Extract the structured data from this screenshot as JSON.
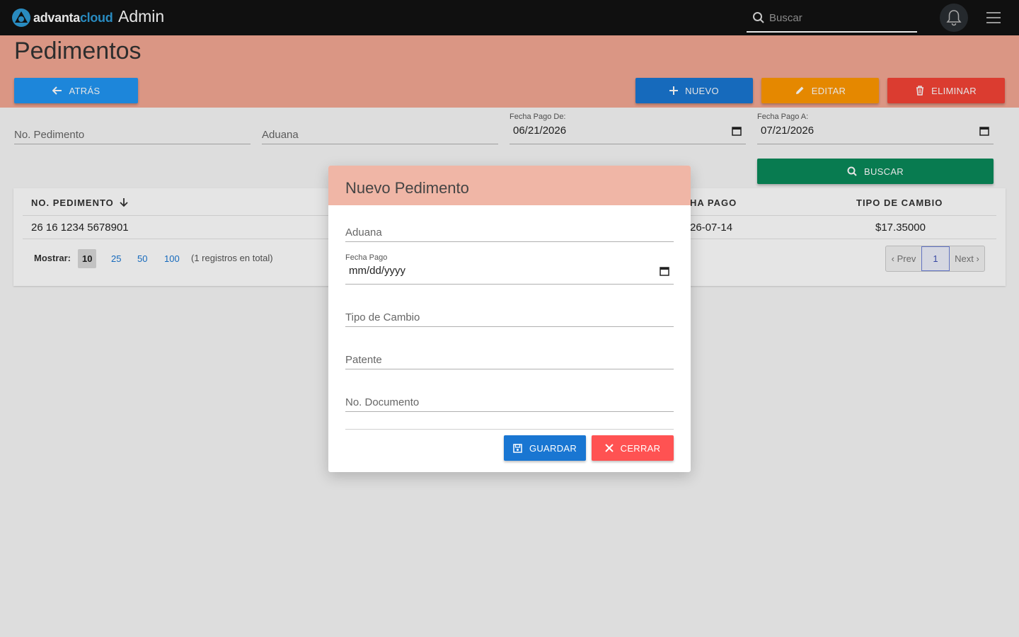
{
  "app": {
    "brand_left": "advanta",
    "brand_right": "cloud",
    "section": "Admin"
  },
  "search": {
    "placeholder": "Buscar"
  },
  "page": {
    "title": "Pedimentos"
  },
  "toolbar": {
    "back_label": "ATRÁS",
    "new_label": "NUEVO",
    "edit_label": "EDITAR",
    "delete_label": "ELIMINAR"
  },
  "filters": {
    "pedimento_placeholder": "No. Pedimento",
    "aduana_placeholder": "Aduana",
    "fecha_de_label": "Fecha Pago De:",
    "fecha_de_value": "06/21/2026",
    "fecha_a_label": "Fecha Pago A:",
    "fecha_a_value": "07/21/2026",
    "search_label": "BUSCAR"
  },
  "table": {
    "columns": [
      "NO. PEDIMENTO",
      "HA PAGO",
      "TIPO DE CAMBIO"
    ],
    "rows": [
      {
        "pedimento": "26 16 1234 5678901",
        "fecha": "26-07-14",
        "tipo_cambio": "$17.35000"
      }
    ],
    "show_label": "Mostrar:",
    "page_sizes": [
      "10",
      "25",
      "50",
      "100"
    ],
    "total_text": "(1 registros en total)",
    "prev_label": "‹ Prev",
    "current_page": "1",
    "next_label": "Next ›"
  },
  "modal": {
    "title": "Nuevo Pedimento",
    "aduana_placeholder": "Aduana",
    "fecha_label": "Fecha Pago",
    "fecha_value": "mm/dd/yyyy",
    "tipo_cambio_placeholder": "Tipo de Cambio",
    "patente_placeholder": "Patente",
    "documento_placeholder": "No. Documento",
    "save_label": "GUARDAR",
    "close_label": "CERRAR"
  },
  "colors": {
    "topbar": "#121212",
    "header_band": "#f3a793",
    "back": "#2196f3",
    "new": "#1976d2",
    "edit": "#ff9800",
    "delete": "#f44336",
    "search": "#0a8a5a",
    "save": "#1976d2",
    "close": "#ff5252"
  }
}
